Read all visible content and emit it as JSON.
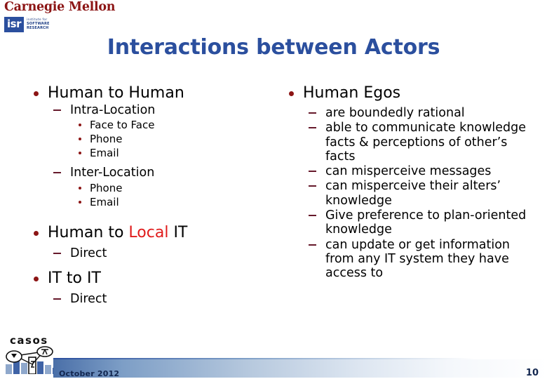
{
  "branding": {
    "university": "Carnegie Mellon",
    "isr_badge": "isr",
    "isr_line1": "institute for",
    "isr_line2": "SOFTWARE",
    "isr_line3": "RESEARCH",
    "casos_word": "casos",
    "accent_blue": "#2b4f9e",
    "accent_red": "#8c1515",
    "highlight_red": "#e01b1b"
  },
  "slide": {
    "title": "Interactions between Actors",
    "number": "10",
    "date": "October 2012"
  },
  "left_column": {
    "item1": {
      "label": "Human to Human",
      "sub1": {
        "label": "Intra-Location",
        "points": [
          "Face to Face",
          "Phone",
          "Email"
        ]
      },
      "sub2": {
        "label": "Inter-Location",
        "points": [
          "Phone",
          "Email"
        ]
      }
    },
    "item2": {
      "label_pre": "Human to ",
      "label_hl": "Local",
      "label_post": " IT",
      "sub1_label": "Direct"
    },
    "item3": {
      "label": "IT to IT",
      "sub1_label": "Direct"
    }
  },
  "right_column": {
    "heading": "Human Egos",
    "points": [
      "are boundedly rational",
      "able to communicate knowledge facts & perceptions of other’s facts",
      "can misperceive messages",
      "can misperceive their alters’ knowledge",
      "Give preference to plan-oriented knowledge",
      "can update or get information from any IT system they have access to"
    ]
  }
}
